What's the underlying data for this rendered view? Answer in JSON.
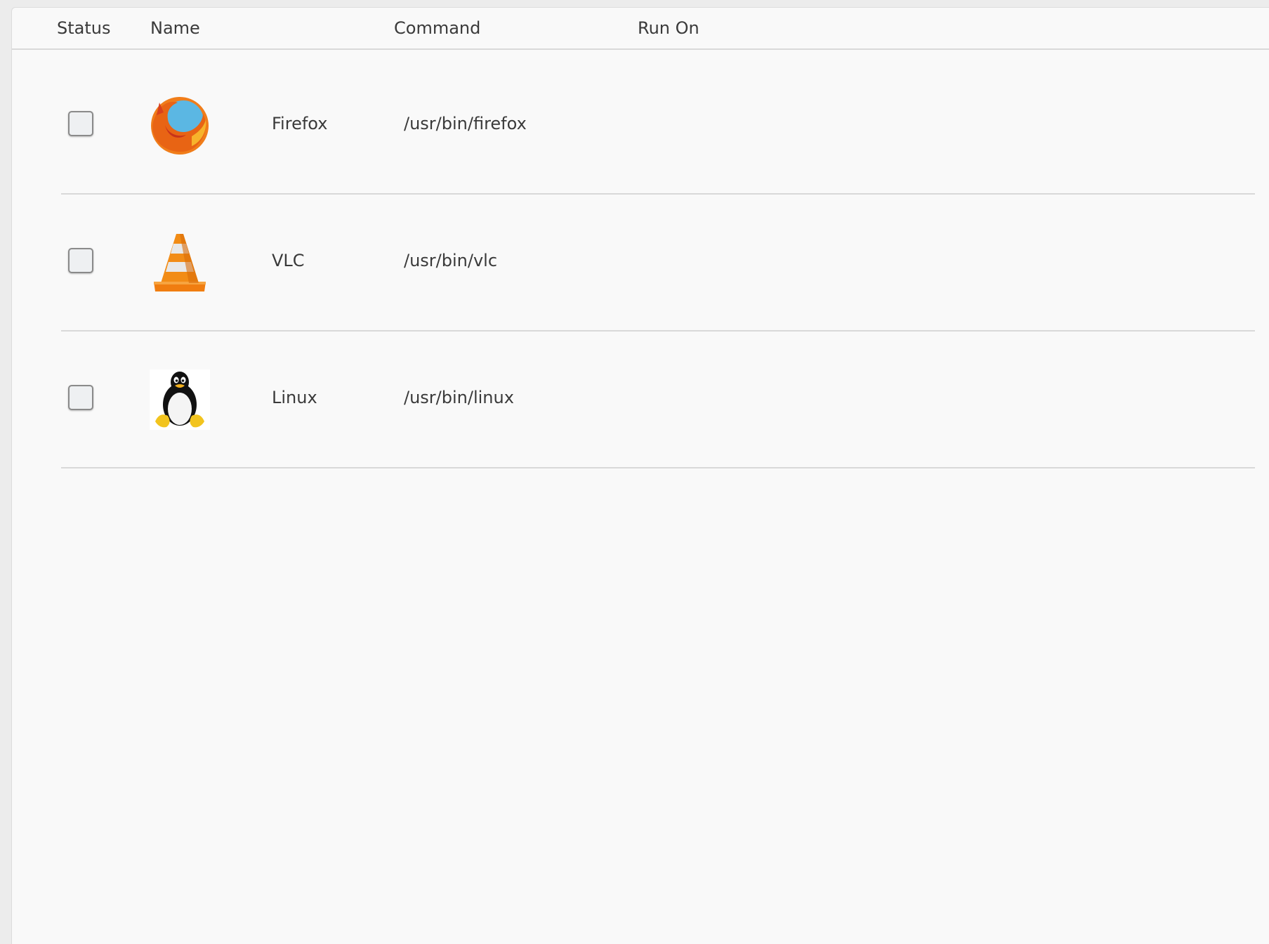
{
  "table": {
    "columns": {
      "status": "Status",
      "name": "Name",
      "command": "Command",
      "run_on": "Run On"
    },
    "rows": [
      {
        "name": "Firefox",
        "command": "/usr/bin/firefox",
        "run_on": "",
        "checked": false,
        "icon": "firefox-icon"
      },
      {
        "name": "VLC",
        "command": "/usr/bin/vlc",
        "run_on": "",
        "checked": false,
        "icon": "vlc-cone-icon"
      },
      {
        "name": "Linux",
        "command": "/usr/bin/linux",
        "run_on": "",
        "checked": false,
        "icon": "tux-penguin-icon"
      }
    ]
  },
  "colors": {
    "panel_background": "#f9f9f9",
    "divider": "#d9d9d9",
    "text": "#3a3a3a"
  }
}
